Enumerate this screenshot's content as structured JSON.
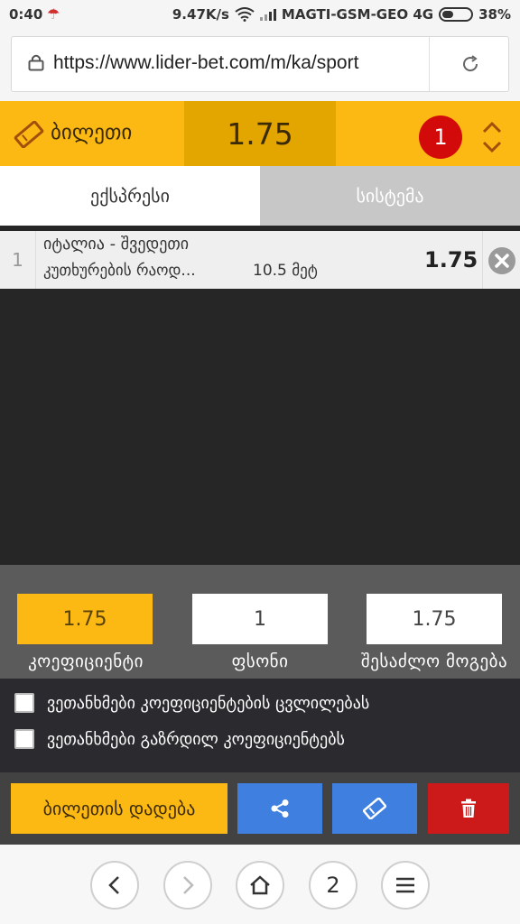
{
  "status_bar": {
    "time": "0:40",
    "speed": "9.47K/s",
    "carrier": "MAGTI-GSM-GEO 4G",
    "battery": "38%"
  },
  "browser": {
    "url": "https://www.lider-bet.com/m/ka/sport",
    "tab_count": "2"
  },
  "ticket": {
    "title": "ბილეთი",
    "total_odds": "1.75",
    "selection_count": "1",
    "tabs": [
      {
        "label": "ექსპრესი",
        "active": true
      },
      {
        "label": "სისტემა",
        "active": false
      }
    ],
    "bets": [
      {
        "index": "1",
        "match": "იტალია - შვედეთი",
        "market": "კუთხურების რაოდ...",
        "line": "10.5 მეტ",
        "odds": "1.75"
      }
    ]
  },
  "summary": {
    "coefficient": "1.75",
    "stake": "1",
    "possible_win": "1.75",
    "coefficient_label": "კოეფიციენტი",
    "stake_label": "ფსონი",
    "possible_win_label": "შესაძლო მოგება"
  },
  "agreements": [
    {
      "label": "ვეთანხმები კოეფიციენტების ცვლილებას",
      "checked": false
    },
    {
      "label": "ვეთანხმები გაზრდილ კოეფიციენტებს",
      "checked": false
    }
  ],
  "actions": {
    "place_bet_label": "ბილეთის დადება"
  },
  "colors": {
    "accent": "#fdb913",
    "accent_dark": "#e3a500",
    "badge": "#d20a0a",
    "action_blue": "#3f7fe0",
    "delete_red": "#cc1a1a"
  },
  "icons": [
    "lock-icon",
    "reload-icon",
    "ticket-icon",
    "expand-collapse-icon",
    "remove-icon",
    "share-icon",
    "ticket-add-icon",
    "trash-icon",
    "back-icon",
    "forward-icon",
    "home-icon",
    "menu-icon"
  ]
}
